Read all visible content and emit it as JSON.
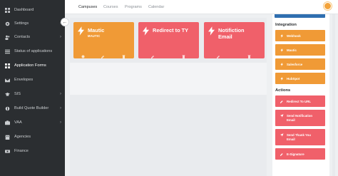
{
  "sidebar": {
    "items": [
      {
        "label": "Dashboard",
        "icon": "dashboard-icon",
        "chevron": false,
        "active": false
      },
      {
        "label": "Settings",
        "icon": "gear-icon",
        "chevron": true,
        "active": false
      },
      {
        "label": "Contacts",
        "icon": "contacts-icon",
        "chevron": true,
        "active": false
      },
      {
        "label": "Status of applications",
        "icon": "list-icon",
        "chevron": false,
        "active": false
      },
      {
        "label": "Application Forms",
        "icon": "forms-icon",
        "chevron": false,
        "active": true
      },
      {
        "label": "Envelopes",
        "icon": "envelope-icon",
        "chevron": false,
        "active": false
      },
      {
        "label": "SIS",
        "icon": "graduation-cap-icon",
        "chevron": true,
        "active": false
      },
      {
        "label": "Build Quote Builder",
        "icon": "builder-icon",
        "chevron": true,
        "active": false
      },
      {
        "label": "VAA",
        "icon": "vaa-icon",
        "chevron": true,
        "active": false
      },
      {
        "label": "Agencies",
        "icon": "agencies-icon",
        "chevron": false,
        "active": false
      },
      {
        "label": "Finance",
        "icon": "finance-icon",
        "chevron": false,
        "active": false
      }
    ],
    "chevron_glyph": "›"
  },
  "topbar": {
    "tabs": [
      {
        "label": "Campuses",
        "active": true
      },
      {
        "label": "Courses",
        "active": false
      },
      {
        "label": "Programs",
        "active": false
      },
      {
        "label": "Calendar",
        "active": false
      }
    ]
  },
  "collapse_button": {
    "glyph": "←"
  },
  "cards": [
    {
      "title": "Mautic",
      "subtitle": "MAUTIC",
      "color": "#f09a36"
    },
    {
      "title": "Redirect to TY",
      "subtitle": "",
      "color": "#f0606a"
    },
    {
      "title": "Notifiction Email",
      "subtitle": "",
      "color": "#f0606a"
    }
  ],
  "panel": {
    "integration": {
      "heading": "Integration",
      "buttons": [
        "Webhook",
        "Mautic",
        "Salesforce",
        "HubSpot"
      ],
      "color": "#f09a36"
    },
    "actions": {
      "heading": "Actions",
      "buttons": [
        "Redirect To URL",
        "Send Notification Email",
        "Send Thank You Email",
        "E-Signature"
      ],
      "color": "#f0606a"
    }
  },
  "colors": {
    "sidebar_bg": "#2b2e31",
    "orange": "#f09a36",
    "red": "#f0606a",
    "blue": "#2f6fb0",
    "avatar": "#f3a33a"
  }
}
